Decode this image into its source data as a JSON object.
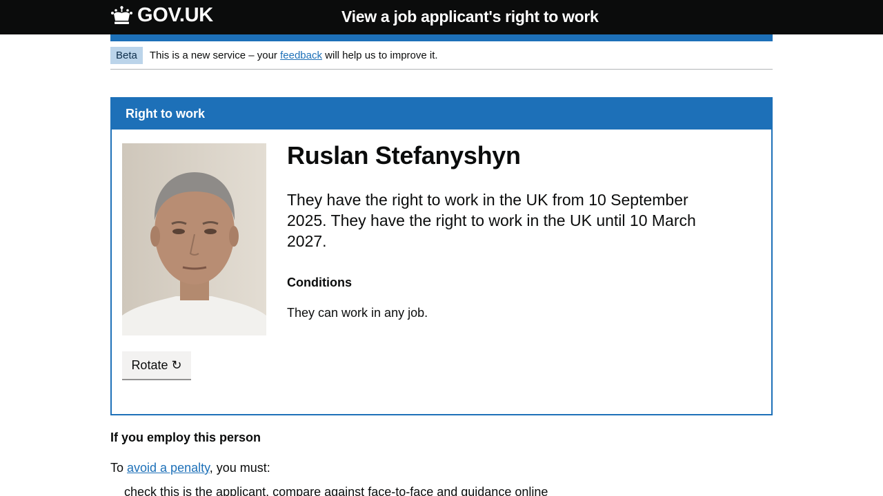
{
  "header": {
    "logo_text": "GOV.UK",
    "service_name": "View a job applicant's right to work"
  },
  "phase_banner": {
    "tag": "Beta",
    "text_before": "This is a new service – your ",
    "link": "feedback",
    "text_after": " will help us to improve it."
  },
  "panel": {
    "title": "Right to work",
    "rotate_label": "Rotate ↻",
    "person_name": "Ruslan Stefanyshyn",
    "status": "They have the right to work in the UK from 10 September 2025. They have the right to work in the UK until 10 March 2027.",
    "conditions_heading": "Conditions",
    "conditions_text": "They can work in any job."
  },
  "employ": {
    "heading": "If you employ this person",
    "text_before": "To ",
    "link": "avoid a penalty",
    "text_after": ", you must:",
    "cut_line": "check this is the applicant, compare against face-to-face and guidance online"
  },
  "colors": {
    "header_bg": "#0b0c0c",
    "brand_blue": "#1d70b8",
    "tag_bg": "#bbd4ea"
  }
}
